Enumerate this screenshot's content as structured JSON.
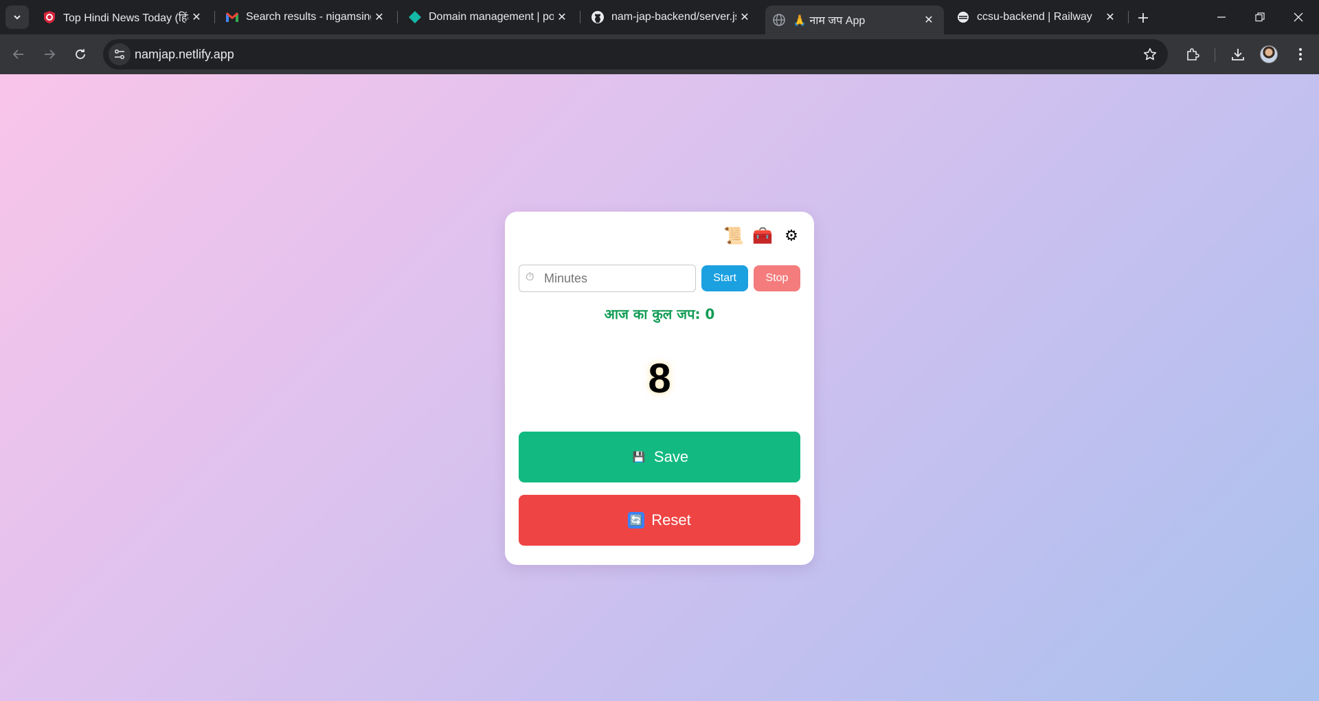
{
  "browser": {
    "tabs": [
      {
        "title": "Top Hindi News Today (हिंदी",
        "icon": "news-logo-icon",
        "active": false
      },
      {
        "title": "Search results - nigamsingh",
        "icon": "gmail-icon",
        "active": false
      },
      {
        "title": "Domain management | por",
        "icon": "netlify-diamond-icon",
        "active": false
      },
      {
        "title": "nam-jap-backend/server.js",
        "icon": "github-icon",
        "active": false
      },
      {
        "title": "🙏 नाम जप App",
        "icon": "globe-icon",
        "active": true
      },
      {
        "title": "ccsu-backend | Railway",
        "icon": "railway-icon",
        "active": false
      }
    ],
    "address": "namjap.netlify.app"
  },
  "app": {
    "minutes_placeholder": "Minutes",
    "stopwatch_glyph": "⏱",
    "start_label": "Start",
    "stop_label": "Stop",
    "total_label": "आज का कुल जप: 0",
    "count": "8",
    "save_label": "Save",
    "save_emoji": "💾",
    "reset_label": "Reset",
    "reset_emoji": "🔄",
    "header_icons": [
      {
        "name": "scroll-icon",
        "glyph": "📜"
      },
      {
        "name": "toolbox-icon",
        "glyph": "🧰"
      },
      {
        "name": "settings-gear-icon",
        "glyph": "⚙"
      }
    ]
  },
  "colors": {
    "save": "#12b981",
    "reset": "#ef4444",
    "start": "#1ba0e0",
    "stop": "#f47c7c",
    "total_text": "#129c55"
  }
}
